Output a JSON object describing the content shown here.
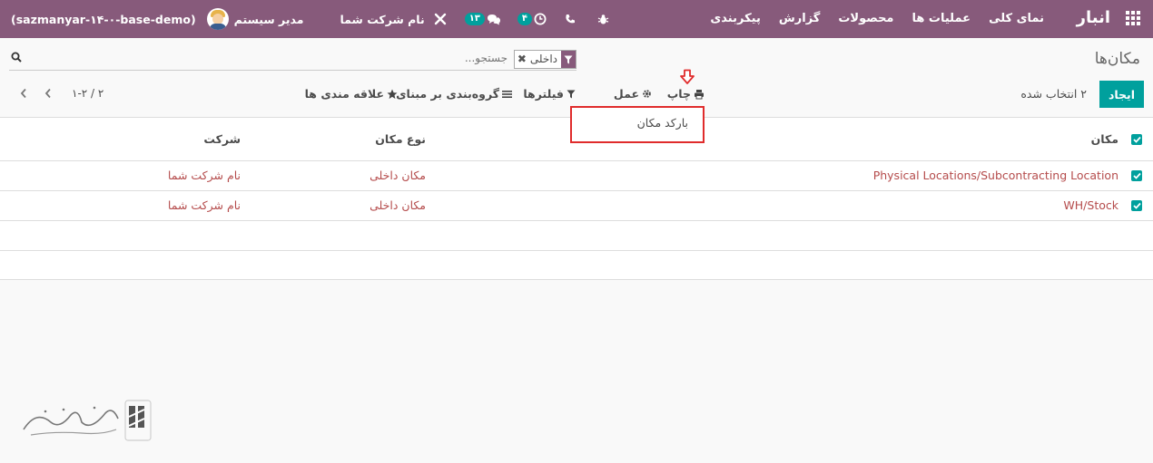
{
  "navbar": {
    "brand": "انبار",
    "menu": [
      "نمای کلی",
      "عملیات ها",
      "محصولات",
      "گزارش",
      "پیکربندی"
    ],
    "company": "نام شرکت شما",
    "user": "مدیر سیستم",
    "database": "(sazmanyar-۱۴-۰-base-demo)",
    "messages_badge": "۱۳",
    "activities_badge": "۴"
  },
  "page": {
    "title": "مکان‌ها"
  },
  "search": {
    "placeholder": "جستجو...",
    "facet_value": "داخلی"
  },
  "toolbar": {
    "create_label": "ایجاد",
    "selected_count": "۲ انتخاب شده",
    "print_label": "چاپ",
    "action_label": "عمل",
    "filters_label": "فیلترها",
    "groupby_label": "گروه‌بندی بر مبنای",
    "favorites_label": "علاقه مندی ها"
  },
  "pager": {
    "value": "۱-۲ / ۲"
  },
  "print_dropdown": {
    "item": "بارکد مکان"
  },
  "table": {
    "columns": {
      "location": "مکان",
      "location_type": "نوع مکان",
      "company": "شرکت"
    },
    "rows": [
      {
        "location": "Physical Locations/Subcontracting Location",
        "location_type": "مکان داخلی",
        "company": "نام شرکت شما"
      },
      {
        "location": "WH/Stock",
        "location_type": "مکان داخلی",
        "company": "نام شرکت شما"
      }
    ]
  },
  "colors": {
    "navbar": "#875a7b",
    "primary": "#00a09d",
    "link": "#b54c4c",
    "highlight": "#e02c2c"
  }
}
